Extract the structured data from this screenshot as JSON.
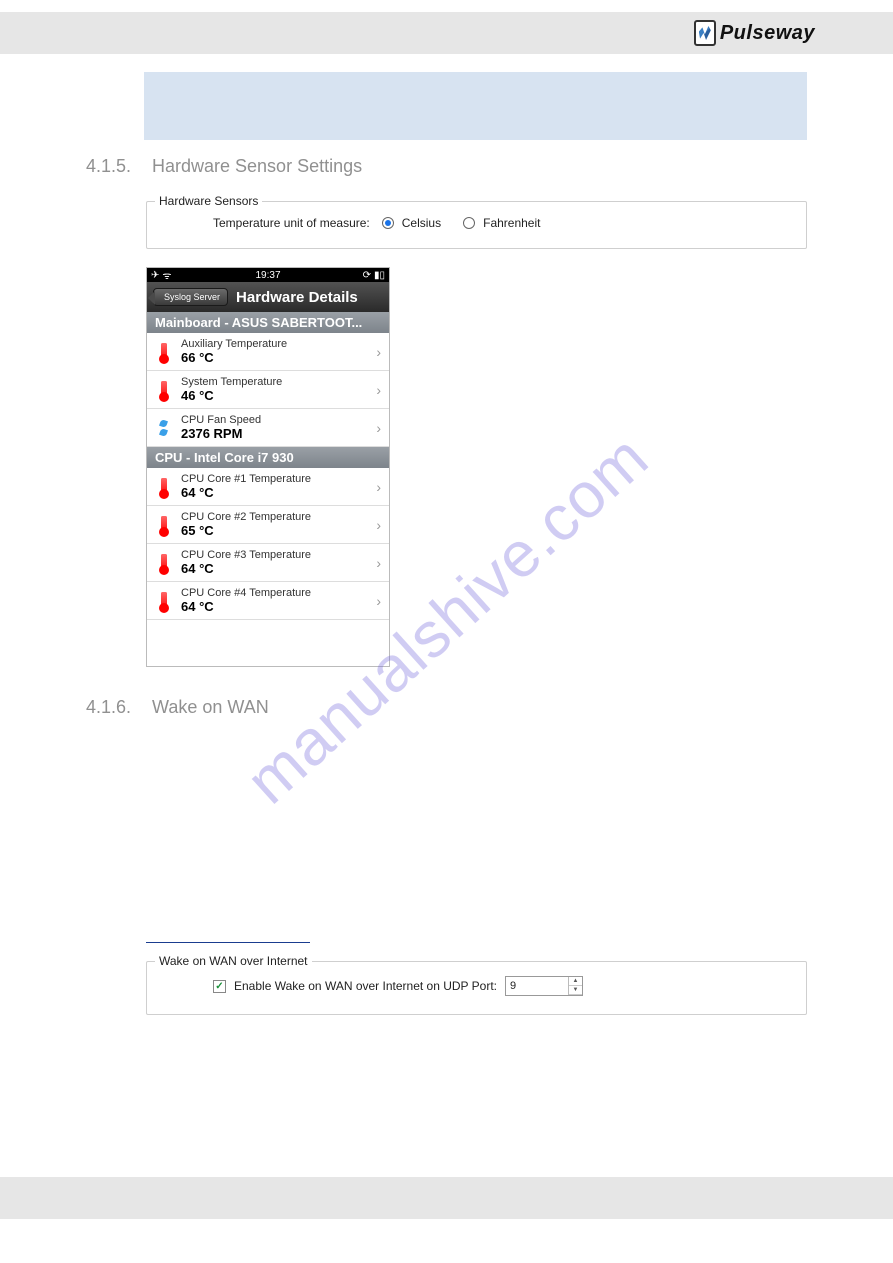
{
  "brand": {
    "name": "Pulseway"
  },
  "watermark": "manualshive.com",
  "section1": {
    "num": "4.1.5.",
    "title": "Hardware Sensor Settings",
    "fieldset_legend": "Hardware Sensors",
    "temp_label": "Temperature unit of measure:",
    "opt_celsius": "Celsius",
    "opt_fahrenheit": "Fahrenheit"
  },
  "phone": {
    "time": "19:37",
    "back_label": "Syslog Server",
    "title": "Hardware Details",
    "group1": "Mainboard - ASUS SABERTOOT...",
    "group2": "CPU - Intel Core i7 930",
    "rows": {
      "r1_label": "Auxiliary Temperature",
      "r1_value": "66 °C",
      "r2_label": "System Temperature",
      "r2_value": "46 °C",
      "r3_label": "CPU Fan Speed",
      "r3_value": "2376 RPM",
      "r4_label": "CPU Core #1 Temperature",
      "r4_value": "64 °C",
      "r5_label": "CPU Core #2 Temperature",
      "r5_value": "65 °C",
      "r6_label": "CPU Core #3 Temperature",
      "r6_value": "64 °C",
      "r7_label": "CPU Core #4 Temperature",
      "r7_value": "64 °C"
    }
  },
  "section2": {
    "num": "4.1.6.",
    "title": "Wake on WAN",
    "fieldset_legend": "Wake on WAN over Internet",
    "checkbox_label": "Enable Wake on WAN over Internet on UDP Port:",
    "port_value": "9"
  }
}
